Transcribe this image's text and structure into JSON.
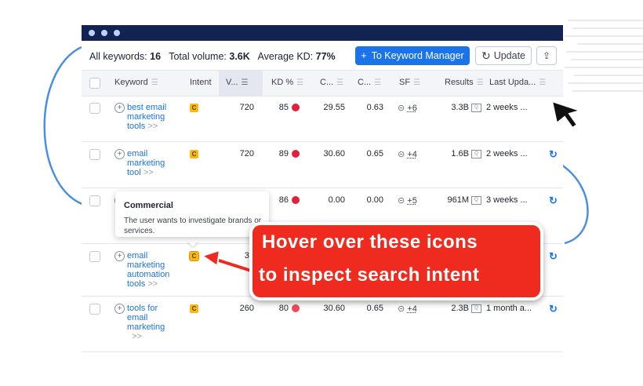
{
  "summary": {
    "all_keywords_label": "All keywords:",
    "all_keywords_value": "16",
    "total_volume_label": "Total volume:",
    "total_volume_value": "3.6K",
    "avg_kd_label": "Average KD:",
    "avg_kd_value": "77%"
  },
  "toolbar": {
    "keyword_manager_label": "To Keyword Manager",
    "update_label": "Update"
  },
  "columns": [
    "Keyword",
    "Intent",
    "V...",
    "KD %",
    "C...",
    "C...",
    "SF",
    "Results",
    "Last Upda..."
  ],
  "rows": [
    {
      "keyword_lines": [
        "best email",
        "marketing",
        "tools"
      ],
      "intent": "C",
      "volume": "720",
      "kd": "85",
      "cpc": "29.55",
      "com": "0.63",
      "sf": "+6",
      "results": "3.3B",
      "last": "2 weeks ..."
    },
    {
      "keyword_lines": [
        "email",
        "marketing",
        "tool"
      ],
      "intent": "C",
      "volume": "720",
      "kd": "89",
      "cpc": "30.60",
      "com": "0.65",
      "sf": "+4",
      "results": "1.6B",
      "last": "2 weeks ..."
    },
    {
      "keyword_lines": [],
      "intent": "",
      "volume": "",
      "kd": "86",
      "cpc": "0.00",
      "com": "0.00",
      "sf": "+5",
      "results": "961M",
      "last": "3 weeks ..."
    },
    {
      "keyword_lines": [
        "email",
        "marketing",
        "automation",
        "tools"
      ],
      "intent": "C",
      "volume": "39",
      "kd": "",
      "cpc": "",
      "com": "",
      "sf": "",
      "results": "",
      "last": ""
    },
    {
      "keyword_lines": [
        "tools for",
        "email",
        "marketing"
      ],
      "intent": "C",
      "volume": "260",
      "kd": "80",
      "cpc": "30.60",
      "com": "0.65",
      "sf": "+4",
      "results": "2.3B",
      "last": "1 month a..."
    }
  ],
  "tooltip": {
    "title": "Commercial",
    "text": "The user wants to investigate brands or services."
  },
  "callout": {
    "line1": "Hover over these icons",
    "line2": "to inspect search intent"
  },
  "colors": {
    "titlebar": "#122352",
    "primary": "#1a73e8",
    "intent_badge": "#fbb80e",
    "kd_dot": "#e0203d",
    "callout": "#ef2b1f"
  }
}
